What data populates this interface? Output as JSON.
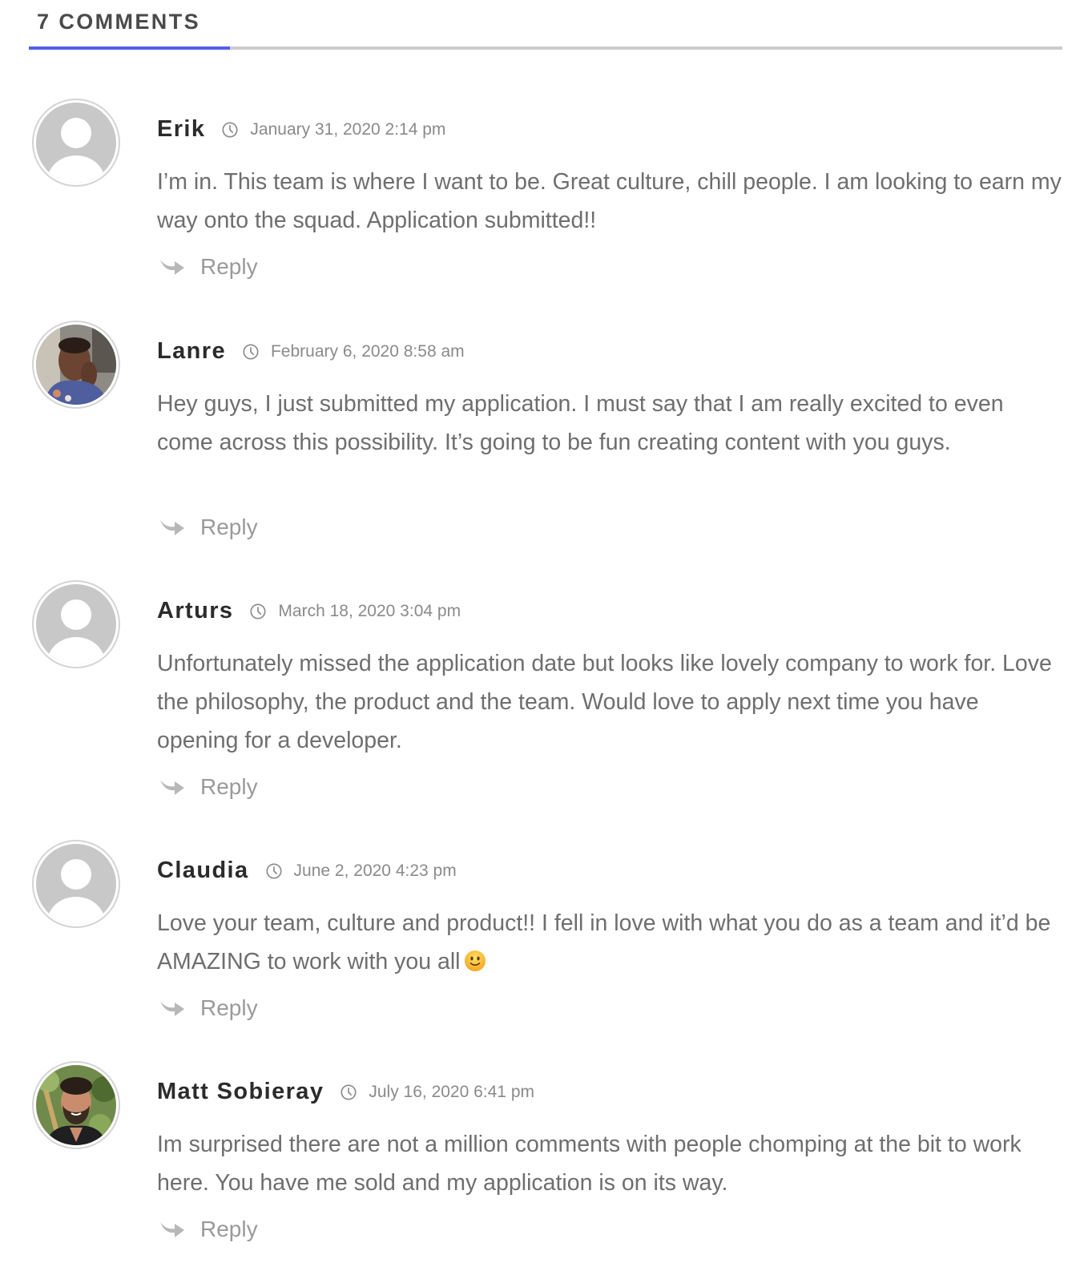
{
  "header": {
    "title": "7 COMMENTS",
    "accent_color": "#5060e6",
    "rule_color": "#cccccc"
  },
  "reply_label": "Reply",
  "reply_icon": "reply-arrow-icon",
  "clock_icon": "clock-icon",
  "comments": [
    {
      "author": "Erik",
      "date": "January 31, 2020 2:14 pm",
      "avatar": "default-avatar",
      "text": "I’m in. This team is where I want to be. Great culture, chill people. I am looking to earn my way onto the squad. Application submitted!!"
    },
    {
      "author": "Lanre",
      "date": "February 6, 2020 8:58 am",
      "avatar": "photo-avatar",
      "text": "Hey guys, I just submitted my application. I must say that I am really excited to even come across this possibility. It’s going to be fun creating content with you guys."
    },
    {
      "author": "Arturs",
      "date": "March 18, 2020 3:04 pm",
      "avatar": "default-avatar",
      "text": "Unfortunately missed the application date but looks like lovely company to work for. Love the philosophy, the product and the team. Would love to apply next time you have opening for a developer."
    },
    {
      "author": "Claudia",
      "date": "June 2, 2020 4:23 pm",
      "avatar": "default-avatar",
      "text": "Love your team, culture and product!! I fell in love with what you do as a team and it’d be AMAZING to work with you all",
      "emoji": "slightly-smiling-face"
    },
    {
      "author": "Matt Sobieray",
      "date": "July 16, 2020 6:41 pm",
      "avatar": "photo-avatar",
      "text": "Im surprised there are not a million comments with people chomping at the bit to work here. You have me sold and my application is on its way."
    }
  ]
}
